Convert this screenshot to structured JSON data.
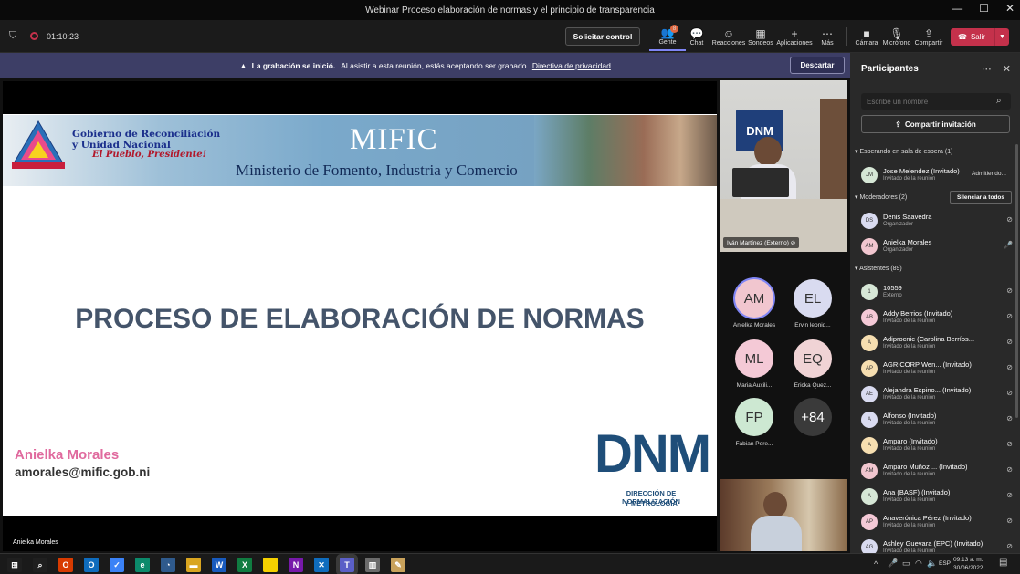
{
  "window": {
    "title": "Webinar Proceso elaboración de normas y el principio de transparencia",
    "minimize": "—",
    "maximize": "☐",
    "close": "✕"
  },
  "toolbar": {
    "timer": "01:10:23",
    "solicitar_control": "Solicitar control",
    "gente_label": "Gente",
    "gente_badge": "8",
    "chat_label": "Chat",
    "reacciones_label": "Reacciones",
    "sondeos_label": "Sondeos",
    "aplicaciones_label": "Aplicaciones",
    "mas_label": "Más",
    "camara_label": "Cámara",
    "microfono_label": "Micrófono",
    "compartir_label": "Compartir",
    "salir_label": "Salir"
  },
  "banner": {
    "bold": "La grabación se inició.",
    "text": "Al asistir a esta reunión, estás aceptando ser grabado.",
    "link": "Directiva de privacidad",
    "dismiss": "Descartar"
  },
  "slide": {
    "gov_line1": "Gobierno de Reconciliación",
    "gov_line2": "y Unidad Nacional",
    "slogan": "El Pueblo, Presidente!",
    "mific": "MIFIC",
    "ministry": "Ministerio de Fomento, Industria y Comercio",
    "title": "PROCESO DE ELABORACIÓN DE NORMAS",
    "presenter_name": "Anielka Morales",
    "presenter_email": "amorales@mific.gob.ni",
    "dnm": "DNM",
    "dnm_sub1": "DIRECCIÓN DE NORMALIZACIÓN",
    "dnm_sub2": "Y METROLOGÍA",
    "sharer_label": "Anielka Morales"
  },
  "videos": {
    "top_label": "Iván Martínez (Externo)",
    "top_logo": "DNM"
  },
  "gallery": [
    {
      "initials": "AM",
      "name": "Anielka Morales",
      "color": "#f1c6cf"
    },
    {
      "initials": "EL",
      "name": "Ervin leonid...",
      "color": "#d9dbf0"
    },
    {
      "initials": "ML",
      "name": "Maria Auxili...",
      "color": "#f4c9d6"
    },
    {
      "initials": "EQ",
      "name": "Ericka Quez...",
      "color": "#f0d3d5"
    },
    {
      "initials": "FP",
      "name": "Fabian Pere...",
      "color": "#cde8d2"
    },
    {
      "initials": "+84",
      "name": "",
      "color": "#3a3a3a"
    }
  ],
  "panel": {
    "title": "Participantes",
    "search_placeholder": "Escribe un nombre",
    "share_invite": "Compartir invitación",
    "waiting_section": "Esperando en sala de espera (1)",
    "moderators_section": "Moderadores (2)",
    "silence_all": "Silenciar a todos",
    "attendees_section": "Asistentes (89)",
    "waiting": [
      {
        "initials": "JM",
        "name": "Jose Melendez (Invitado)",
        "role": "Invitado de la reunión",
        "extra": "Admitiendo...",
        "color": "#d6e7d6"
      }
    ],
    "moderators": [
      {
        "initials": "DS",
        "name": "Denis Saavedra",
        "role": "Organizador",
        "color": "#d9dbf0"
      },
      {
        "initials": "AM",
        "name": "Anielka Morales",
        "role": "Organizador",
        "color": "#f1c6cf"
      }
    ],
    "attendees": [
      {
        "initials": "1",
        "name": "10559",
        "role": "Externo",
        "color": "#d6e7d6"
      },
      {
        "initials": "AB",
        "name": "Addy Berrios (Invitado)",
        "role": "Invitado de la reunión",
        "color": "#f4c9d6"
      },
      {
        "initials": "A",
        "name": "Adiprocnic (Carolina Berríos...",
        "role": "Invitado de la reunión",
        "color": "#f6deb0"
      },
      {
        "initials": "AP",
        "name": "AGRICORP Wen...  (Invitado)",
        "role": "Invitado de la reunión",
        "color": "#f6deb0"
      },
      {
        "initials": "AE",
        "name": "Alejandra Espino...  (Invitado)",
        "role": "Invitado de la reunión",
        "color": "#d9dbf0"
      },
      {
        "initials": "A",
        "name": "Alfonso (Invitado)",
        "role": "Invitado de la reunión",
        "color": "#d9dbf0"
      },
      {
        "initials": "A",
        "name": "Amparo (Invitado)",
        "role": "Invitado de la reunión",
        "color": "#f6deb0"
      },
      {
        "initials": "AM",
        "name": "Amparo Muñoz ...  (Invitado)",
        "role": "Invitado de la reunión",
        "color": "#f1c6cf"
      },
      {
        "initials": "A",
        "name": "Ana (BASF) (Invitado)",
        "role": "Invitado de la reunión",
        "color": "#d6e7d6"
      },
      {
        "initials": "AP",
        "name": "Anaverónica Pérez (Invitado)",
        "role": "Invitado de la reunión",
        "color": "#f4c9d6"
      },
      {
        "initials": "AG",
        "name": "Ashley Guevara (EPC) (Invitado)",
        "role": "Invitado de la reunión",
        "color": "#d9dbf0"
      }
    ]
  },
  "taskbar": {
    "time": "09:13 a. m.",
    "date": "30/06/2022",
    "lang": "ESP",
    "apps": [
      "start",
      "search",
      "office",
      "outlook",
      "todo",
      "edge",
      "vpn",
      "explorer",
      "word",
      "excel",
      "sticky",
      "onenote",
      "snip",
      "teams",
      "library",
      "notepad"
    ]
  }
}
